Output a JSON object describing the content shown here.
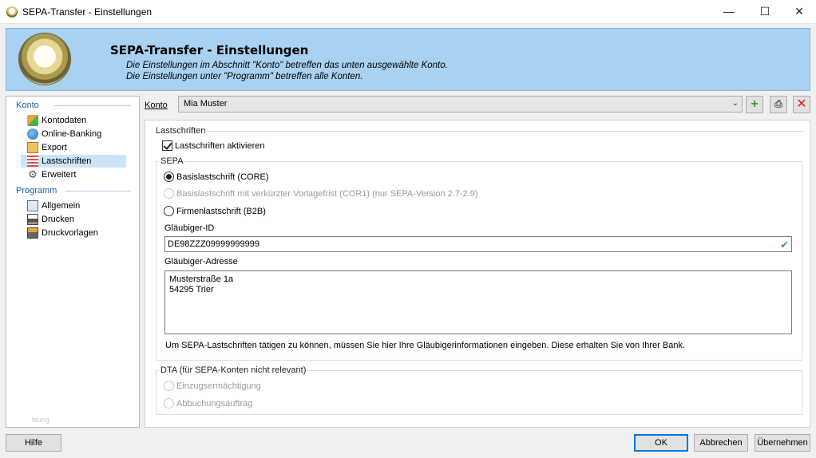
{
  "window": {
    "title": "SEPA-Transfer - Einstellungen"
  },
  "header": {
    "title": "SEPA-Transfer - Einstellungen",
    "subtitle_1": "Die Einstellungen im Abschnitt \"Konto\" betreffen das unten ausgewählte Konto.",
    "subtitle_2": "Die Einstellungen unter \"Programm\" betreffen alle Konten."
  },
  "sidebar": {
    "konto_title": "Konto",
    "konto_items": [
      {
        "label": "Kontodaten",
        "icon": "bank-icon"
      },
      {
        "label": "Online-Banking",
        "icon": "globe-icon"
      },
      {
        "label": "Export",
        "icon": "export-icon"
      },
      {
        "label": "Lastschriften",
        "icon": "debit-icon",
        "selected": true
      },
      {
        "label": "Erweitert",
        "icon": "gear-icon"
      }
    ],
    "programm_title": "Programm",
    "programm_items": [
      {
        "label": "Allgemein",
        "icon": "settings-window-icon"
      },
      {
        "label": "Drucken",
        "icon": "printer-icon"
      },
      {
        "label": "Druckvorlagen",
        "icon": "template-icon"
      }
    ],
    "watermark": "blung"
  },
  "konto": {
    "label": "Konto",
    "selected": "Mia Muster"
  },
  "lastschriften": {
    "group_label": "Lastschriften",
    "activate_label": "Lastschriften aktivieren",
    "activate_checked": true
  },
  "sepa": {
    "group_label": "SEPA",
    "options": [
      {
        "label": "Basislastschrift (CORE)",
        "checked": true,
        "disabled": false
      },
      {
        "label": "Basislastschrift mit verkürzter Vorlagefrist (COR1) (nur SEPA-Version 2.7-2.9)",
        "checked": false,
        "disabled": true
      },
      {
        "label": "Firmenlastschrift (B2B)",
        "checked": false,
        "disabled": false
      }
    ],
    "creditor_id_label": "Gläubiger-ID",
    "creditor_id_value": "DE98ZZZ09999999999",
    "creditor_address_label": "Gläubiger-Adresse",
    "address_line_1": "Musterstraße 1a",
    "address_line_2": "54295 Trier",
    "info": "Um SEPA-Lastschriften tätigen zu können, müssen Sie hier Ihre Gläubigerinformationen eingeben. Diese erhalten Sie von Ihrer Bank."
  },
  "dta": {
    "group_label": "DTA (für SEPA-Konten nicht relevant)",
    "options": [
      {
        "label": "Einzugsermächtigung",
        "disabled": true
      },
      {
        "label": "Abbuchungsauftrag",
        "disabled": true
      }
    ]
  },
  "buttons": {
    "help": "Hilfe",
    "ok": "OK",
    "cancel": "Abbrechen",
    "apply": "Übernehmen"
  },
  "colors": {
    "header_bg": "#a8d1f2",
    "section_title": "#1e5aa8",
    "selected_bg": "#cce4f7",
    "add_green": "#2f9e2f",
    "delete_red": "#d02020"
  }
}
